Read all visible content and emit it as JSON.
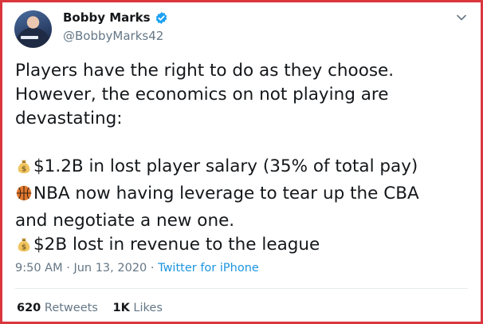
{
  "user": {
    "display_name": "Bobby Marks",
    "handle": "@BobbyMarks42",
    "verified": true
  },
  "tweet": {
    "lines": [
      "Players have the right to do as they choose.",
      "However, the economics on not playing are",
      "devastating:"
    ],
    "bullets": [
      {
        "icon": "money-bag-icon",
        "text": "$1.2B in lost player salary (35% of total pay)"
      },
      {
        "icon": "basketball-icon",
        "text": "NBA now having leverage to tear up the CBA"
      },
      {
        "icon": "",
        "text": "and negotiate a new one."
      },
      {
        "icon": "money-bag-icon",
        "text": "$2B lost in revenue to the league"
      }
    ]
  },
  "meta": {
    "time": "9:50 AM",
    "separator": "·",
    "date": "Jun 13, 2020",
    "source": "Twitter for iPhone"
  },
  "stats": {
    "retweets_count": "620",
    "retweets_label": "Retweets",
    "likes_count": "1K",
    "likes_label": "Likes"
  },
  "colors": {
    "border": "#d9363e",
    "verified": "#1da1f2",
    "link": "#1b95e0",
    "secondary_text": "#657786"
  }
}
